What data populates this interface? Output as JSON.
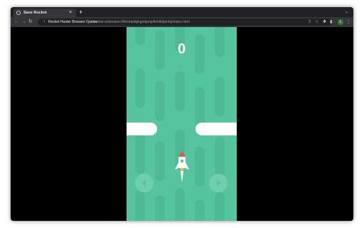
{
  "browser": {
    "tab_title": "Save Rocket",
    "site_name": "Rocket Hunter Browser Games",
    "url": "chrome-extension://lfokmpldpkgmlpmpiflohlkdpinhp/index.html",
    "avatar_letter": "L",
    "accent": "#2e7d32"
  },
  "game": {
    "score": "0",
    "background": "#57c4a0",
    "wall_color": "#ffffff"
  },
  "icons": {
    "back": "←",
    "forward": "→",
    "reload": "↻",
    "close": "×",
    "new_tab": "+",
    "menu": "⋮"
  }
}
